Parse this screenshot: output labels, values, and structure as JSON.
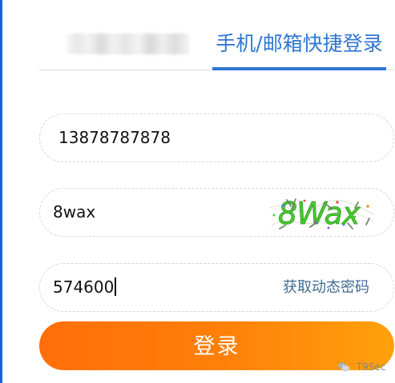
{
  "tabs": {
    "active_label": "手机/邮箱快捷登录"
  },
  "form": {
    "phone_value": "13878787878",
    "captcha_value": "8wax",
    "captcha_image_text": "8Wax",
    "sms_value": "574600",
    "sms_link_label": "获取动态密码"
  },
  "login_label": "登录",
  "watermark": {
    "text": "T9Sec",
    "icon": "wechat-icon"
  },
  "colors": {
    "active_tab": "#2f77d2",
    "left_edge": "#0d68d8",
    "field_border": "#d2d7df",
    "sms_link": "#3f6b93",
    "button_start": "#ff6e0a",
    "button_end": "#ffa10b",
    "captcha_text": "#49c92f"
  }
}
